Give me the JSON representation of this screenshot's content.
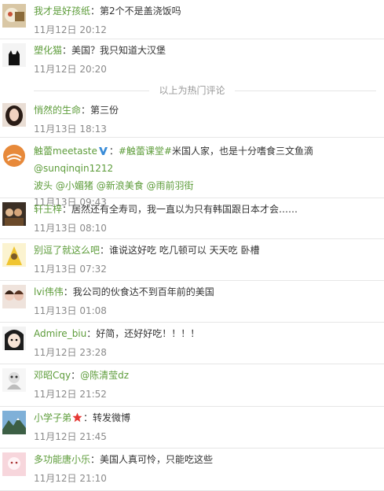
{
  "comments": [
    {
      "user": "我才是好孩纸",
      "text": "第2个不是盖浇饭吗",
      "time": "11月12日 20:12",
      "avatar": "avatar-food"
    },
    {
      "user": "塑化猫",
      "text": "美国？我只知道大汉堡",
      "time": "11月12日 20:20",
      "avatar": "avatar-black-cat"
    }
  ],
  "hot_divider": "以上为热门评论",
  "comments2": [
    {
      "user": "悄然的生命",
      "text": "第三份",
      "time": "11月13日 18:13",
      "avatar": "avatar-girl"
    },
    {
      "user": "触蕾meetaste",
      "verified_icon": "v-verified-icon",
      "text_prefix": "#触蕾课堂#",
      "text": "米国人家，也是十分嗜食三文鱼滴",
      "mentions": [
        "@sunqinqin1212",
        "波头",
        "@小媚猪",
        "@新浪美食",
        "@雨前羽街"
      ],
      "time": "11月13日 09:43",
      "avatar": "avatar-logo-orange"
    },
    {
      "user": "轩王梓",
      "text": "居然还有全寿司，我一直以为只有韩国跟日本才会……",
      "time": "11月13日 08:10",
      "avatar": "avatar-group"
    },
    {
      "user": "别逗了就这么吧",
      "text": "谁说这好吃 吃几顿可以 天天吃 卧槽",
      "time": "11月13日 07:32",
      "avatar": "avatar-cartoon"
    },
    {
      "user": "lvi伟伟",
      "text": "我公司的伙食达不到百年前的美国",
      "time": "11月13日 01:08",
      "avatar": "avatar-two-girls"
    },
    {
      "user": "Admire_biu",
      "text": "好简，还好好吃！！！！",
      "time": "11月12日 23:28",
      "avatar": "avatar-anime"
    },
    {
      "user": "邓昭Cqy",
      "mention": "@陈清莹dz",
      "time": "11月12日 21:52",
      "avatar": "avatar-toy"
    },
    {
      "user": "小学子弟",
      "badge_icon": "red-star-icon",
      "text": "转发微博",
      "time": "11月12日 21:45",
      "avatar": "avatar-landscape"
    },
    {
      "user": "多功能唐小乐",
      "text": "美国人真可怜，只能吃这些",
      "time": "11月12日 21:10",
      "avatar": "avatar-pink"
    }
  ],
  "colors": {
    "name": "#5d9c3a",
    "text": "#333333",
    "time": "#8a8a8a",
    "divider": "#e6e6e6",
    "badge_v": "#3a8cd8",
    "badge_star": "#e53935"
  }
}
